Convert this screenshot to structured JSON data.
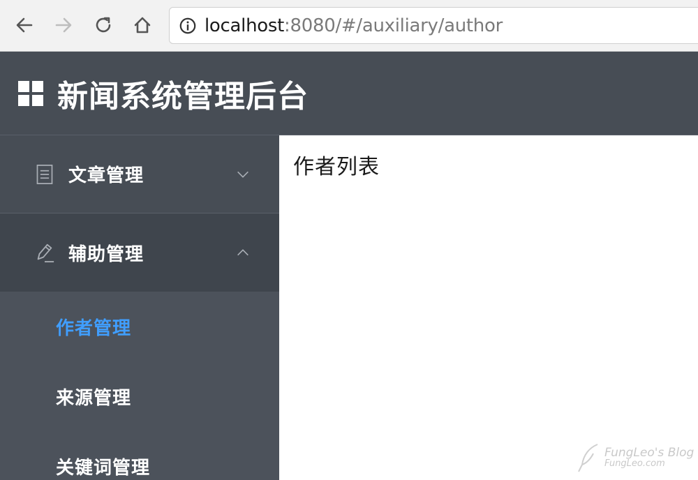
{
  "browser": {
    "url_host": "localhost",
    "url_rest": ":8080/#/auxiliary/author",
    "icons": [
      "back-arrow-icon",
      "forward-arrow-icon",
      "reload-icon",
      "home-icon",
      "info-icon"
    ]
  },
  "header": {
    "title": "新闻系统管理后台",
    "logo_icon": "grid-icon",
    "background": "#474d55"
  },
  "sidebar": {
    "background": "#474d55",
    "groups": [
      {
        "label": "文章管理",
        "icon": "document-icon",
        "expanded": false,
        "chevron": "chevron-down-icon"
      },
      {
        "label": "辅助管理",
        "icon": "pencil-icon",
        "expanded": true,
        "chevron": "chevron-up-icon",
        "items": [
          {
            "label": "作者管理",
            "active": true
          },
          {
            "label": "来源管理",
            "active": false
          },
          {
            "label": "关键词管理",
            "active": false
          }
        ]
      }
    ],
    "active_color": "#409eff"
  },
  "main": {
    "title": "作者列表"
  },
  "watermark": {
    "line1": "FungLeo's Blog",
    "line2": "FungLeo.com"
  }
}
